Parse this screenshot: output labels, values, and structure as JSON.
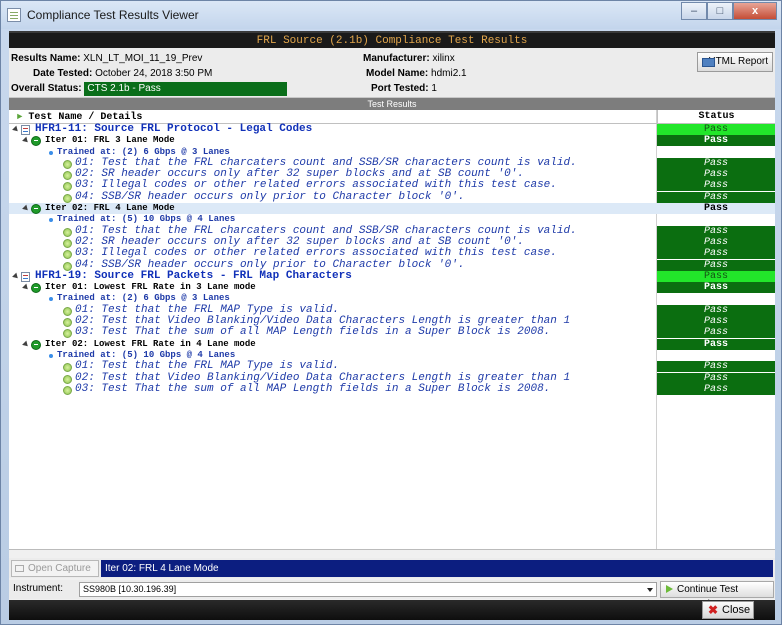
{
  "window": {
    "title": "Compliance Test Results Viewer",
    "minimize": "–",
    "maximize": "□",
    "close": "x"
  },
  "banner": "FRL Source (2.1b) Compliance Test Results",
  "info": {
    "results_name_label": "Results Name:",
    "results_name": "XLN_LT_MOI_11_19_Prev",
    "date_label": "Date Tested:",
    "date": "October 24, 2018 3:50 PM",
    "overall_label": "Overall Status:",
    "overall": "CTS 2.1b - Pass",
    "manufacturer_label": "Manufacturer:",
    "manufacturer": "xilinx",
    "model_label": "Model Name:",
    "model": "hdmi2.1",
    "port_label": "Port Tested:",
    "port": "1",
    "html_report": "HTML Report"
  },
  "results_header": "Test Results",
  "table": {
    "col_name": "Test Name / Details",
    "col_status": "Status",
    "rows": [
      {
        "level": 0,
        "text": "HFR1-11: Source FRL Protocol - Legal Codes",
        "status": "Pass",
        "style": "lime"
      },
      {
        "level": 1,
        "text": "Iter 01: FRL 3 Lane Mode",
        "status": "Pass",
        "style": "dark"
      },
      {
        "level": 2,
        "text": "Trained at: (2) 6 Gbps @ 3 Lanes",
        "status": "",
        "style": ""
      },
      {
        "level": 3,
        "text": "01: Test that the FRL charcaters count and SSB/SR characters count is valid.",
        "status": "Pass",
        "style": "darki"
      },
      {
        "level": 3,
        "text": "02: SR header occurs only after 32 super blocks and at SB count '0'.",
        "status": "Pass",
        "style": "darki"
      },
      {
        "level": 3,
        "text": "03: Illegal codes or other related errors associated with this test case.",
        "status": "Pass",
        "style": "darki"
      },
      {
        "level": 3,
        "text": "04: SSB/SR header occurs only prior to Character block '0'.",
        "status": "Pass",
        "style": "darki"
      },
      {
        "level": 1,
        "text": "Iter 02: FRL 4 Lane Mode",
        "status": "Pass",
        "style": "plain",
        "selected": true
      },
      {
        "level": 2,
        "text": "Trained at: (5) 10 Gbps @ 4 Lanes",
        "status": "",
        "style": ""
      },
      {
        "level": 3,
        "text": "01: Test that the FRL charcaters count and SSB/SR characters count is valid.",
        "status": "Pass",
        "style": "darki"
      },
      {
        "level": 3,
        "text": "02: SR header occurs only after 32 super blocks and at SB count '0'.",
        "status": "Pass",
        "style": "darki"
      },
      {
        "level": 3,
        "text": "03: Illegal codes or other related errors associated with this test case.",
        "status": "Pass",
        "style": "darki"
      },
      {
        "level": 3,
        "text": "04: SSB/SR header occurs only prior to Character block '0'.",
        "status": "Pass",
        "style": "darki"
      },
      {
        "level": 0,
        "text": "HFR1-19: Source FRL Packets - FRL Map Characters",
        "status": "Pass",
        "style": "lime"
      },
      {
        "level": 1,
        "text": "Iter 01: Lowest FRL Rate in 3 Lane mode",
        "status": "Pass",
        "style": "dark"
      },
      {
        "level": 2,
        "text": "Trained at: (2) 6 Gbps @ 3 Lanes",
        "status": "",
        "style": ""
      },
      {
        "level": 3,
        "text": "01: Test that the FRL MAP Type is valid.",
        "status": "Pass",
        "style": "darki"
      },
      {
        "level": 3,
        "text": "02: Test that Video Blanking/Video Data Characters Length is greater than 1",
        "status": "Pass",
        "style": "darki"
      },
      {
        "level": 3,
        "text": "03: Test That the sum of all MAP Length fields in a Super Block is 2008.",
        "status": "Pass",
        "style": "darki"
      },
      {
        "level": 1,
        "text": "Iter 02: Lowest FRL Rate in 4 Lane mode",
        "status": "Pass",
        "style": "dark"
      },
      {
        "level": 2,
        "text": "Trained at: (5) 10 Gbps @ 4 Lanes",
        "status": "",
        "style": ""
      },
      {
        "level": 3,
        "text": "01: Test that the FRL MAP Type is valid.",
        "status": "Pass",
        "style": "darki"
      },
      {
        "level": 3,
        "text": "02: Test that Video Blanking/Video Data Characters Length is greater than 1",
        "status": "Pass",
        "style": "darki"
      },
      {
        "level": 3,
        "text": "03: Test That the sum of all MAP Length fields in a Super Block is 2008.",
        "status": "Pass",
        "style": "darki"
      }
    ]
  },
  "bottom": {
    "open_capture": "Open Capture",
    "current_item": "Iter 02: FRL 4 Lane Mode",
    "instrument_label": "Instrument:",
    "instrument": "SS980B [10.30.196.39]",
    "continue": "Continue Test Execution",
    "close": "Close"
  },
  "colors": {
    "pass_lime": "#22e62a",
    "pass_dark": "#0b6e10",
    "banner_text": "#e2a64c",
    "link_blue": "#1030b8"
  }
}
